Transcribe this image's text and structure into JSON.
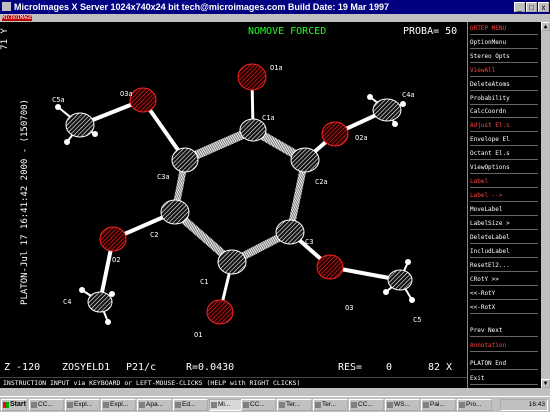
{
  "window": {
    "title": "MicroImages X Server  1024x740x24 bit  tech@microimages.com  Build Date: 19 Mar 1997",
    "controls": [
      "_",
      "□",
      "x"
    ],
    "menu_item": "MICROIMAGES"
  },
  "graphics": {
    "header_center": "NOMOVE FORCED",
    "header_right": "PROBA=  50",
    "left_axis_label": "PLATON-Jul 17 16:41:42 2000 - (150700)",
    "left_axis_top": "71 Y",
    "status": {
      "z": "Z -120",
      "name": "ZOSYELD1",
      "space_group": "P21/c",
      "r": "R=0.0430",
      "res": "RES=",
      "res_val": "0",
      "x": "82 X"
    },
    "atom_labels": [
      "C5a",
      "O3a",
      "O1a",
      "C1a",
      "O2a",
      "C4a",
      "C3a",
      "C2a",
      "C2",
      "O2",
      "C4",
      "C1",
      "C3",
      "O1",
      "O3",
      "C5"
    ]
  },
  "command_line": "INSTRUCTION INPUT via KEYBOARD or LEFT-MOUSE-CLICKS (HELP with RIGHT CLICKS)",
  "side_menu": [
    {
      "label": "ORTEP MENU",
      "color": "#ff4040"
    },
    {
      "label": "OptionMenu",
      "color": "#ffffff"
    },
    {
      "label": "Stereo Opts",
      "color": "#ffffff"
    },
    {
      "label": "ViewAll",
      "color": "#ff4040"
    },
    {
      "label": "DeleteAtoms",
      "color": "#ffffff"
    },
    {
      "label": "Probability",
      "color": "#ffffff"
    },
    {
      "label": "CalcCoordn",
      "color": "#ffffff"
    },
    {
      "label": "Adjust El.s",
      "color": "#ff4040"
    },
    {
      "label": "Envelope El",
      "color": "#ffffff"
    },
    {
      "label": "Octant El.s",
      "color": "#ffffff"
    },
    {
      "label": "ViewOptions",
      "color": "#ffffff"
    },
    {
      "label": "Label",
      "color": "#ff4040"
    },
    {
      "label": "Label -->",
      "color": "#ff4040"
    },
    {
      "label": "MoveLabel",
      "color": "#ffffff"
    },
    {
      "label": "LabelSize >",
      "color": "#ffffff"
    },
    {
      "label": "DeleteLabel",
      "color": "#ffffff"
    },
    {
      "label": "IncludLabel",
      "color": "#ffffff"
    },
    {
      "label": "ResetEl2...",
      "color": "#ffffff"
    },
    {
      "label": "CRotY >>",
      "color": "#ffffff"
    },
    {
      "label": "<<-RotY",
      "color": "#ffffff"
    },
    {
      "label": "<<-RotX",
      "color": "#ffffff"
    },
    {
      "label": "Prev   Next",
      "color": "#ffffff"
    },
    {
      "label": "Annotation",
      "color": "#ff4040"
    },
    {
      "label": "PLATON  End",
      "color": "#ffffff"
    },
    {
      "label": "Exit",
      "color": "#ffffff"
    }
  ],
  "taskbar": {
    "start": "Start",
    "buttons": [
      "CC...",
      "Expl...",
      "Expl...",
      "Apa...",
      "Ed...",
      "Mi...",
      "CC...",
      "Ter...",
      "Ter...",
      "CC...",
      "WS...",
      "Pai...",
      "Pro..."
    ],
    "active_index": 5,
    "clock": "16:43"
  }
}
